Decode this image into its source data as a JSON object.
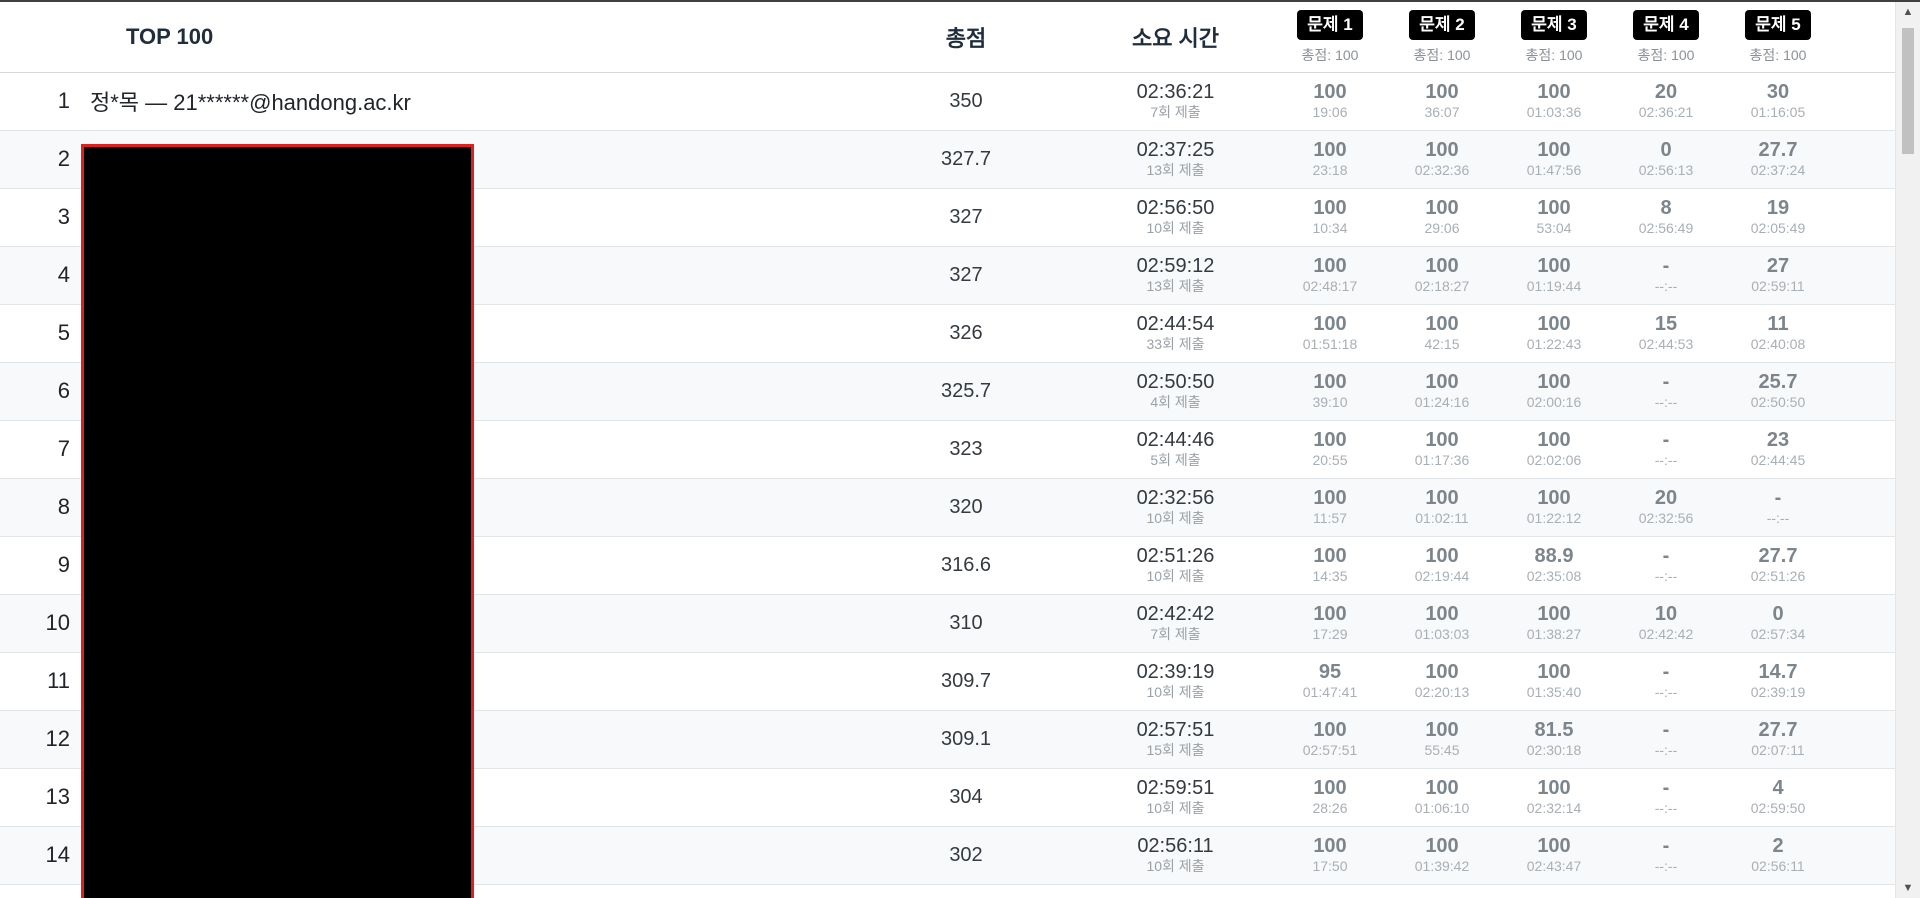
{
  "header": {
    "title": "TOP 100",
    "total_label": "총점",
    "time_label": "소요 시간",
    "problems": [
      {
        "label": "문제 1",
        "total": "총점: 100"
      },
      {
        "label": "문제 2",
        "total": "총점: 100"
      },
      {
        "label": "문제 3",
        "total": "총점: 100"
      },
      {
        "label": "문제 4",
        "total": "총점: 100"
      },
      {
        "label": "문제 5",
        "total": "총점: 100"
      }
    ]
  },
  "rows": [
    {
      "rank": "1",
      "user": "정*목 — 21******@handong.ac.kr",
      "total": "350",
      "time": "02:36:21",
      "submits": "7회 제출",
      "scores": [
        {
          "s": "100",
          "t": "19:06"
        },
        {
          "s": "100",
          "t": "36:07"
        },
        {
          "s": "100",
          "t": "01:03:36"
        },
        {
          "s": "20",
          "t": "02:36:21"
        },
        {
          "s": "30",
          "t": "01:16:05"
        }
      ]
    },
    {
      "rank": "2",
      "user": "",
      "total": "327.7",
      "time": "02:37:25",
      "submits": "13회 제출",
      "scores": [
        {
          "s": "100",
          "t": "23:18"
        },
        {
          "s": "100",
          "t": "02:32:36"
        },
        {
          "s": "100",
          "t": "01:47:56"
        },
        {
          "s": "0",
          "t": "02:56:13"
        },
        {
          "s": "27.7",
          "t": "02:37:24"
        }
      ]
    },
    {
      "rank": "3",
      "user": "",
      "total": "327",
      "time": "02:56:50",
      "submits": "10회 제출",
      "scores": [
        {
          "s": "100",
          "t": "10:34"
        },
        {
          "s": "100",
          "t": "29:06"
        },
        {
          "s": "100",
          "t": "53:04"
        },
        {
          "s": "8",
          "t": "02:56:49"
        },
        {
          "s": "19",
          "t": "02:05:49"
        }
      ]
    },
    {
      "rank": "4",
      "user": "",
      "total": "327",
      "time": "02:59:12",
      "submits": "13회 제출",
      "scores": [
        {
          "s": "100",
          "t": "02:48:17"
        },
        {
          "s": "100",
          "t": "02:18:27"
        },
        {
          "s": "100",
          "t": "01:19:44"
        },
        {
          "s": "-",
          "t": "--:--"
        },
        {
          "s": "27",
          "t": "02:59:11"
        }
      ]
    },
    {
      "rank": "5",
      "user": "",
      "total": "326",
      "time": "02:44:54",
      "submits": "33회 제출",
      "scores": [
        {
          "s": "100",
          "t": "01:51:18"
        },
        {
          "s": "100",
          "t": "42:15"
        },
        {
          "s": "100",
          "t": "01:22:43"
        },
        {
          "s": "15",
          "t": "02:44:53"
        },
        {
          "s": "11",
          "t": "02:40:08"
        }
      ]
    },
    {
      "rank": "6",
      "user": "",
      "total": "325.7",
      "time": "02:50:50",
      "submits": "4회 제출",
      "scores": [
        {
          "s": "100",
          "t": "39:10"
        },
        {
          "s": "100",
          "t": "01:24:16"
        },
        {
          "s": "100",
          "t": "02:00:16"
        },
        {
          "s": "-",
          "t": "--:--"
        },
        {
          "s": "25.7",
          "t": "02:50:50"
        }
      ]
    },
    {
      "rank": "7",
      "user": "",
      "total": "323",
      "time": "02:44:46",
      "submits": "5회 제출",
      "scores": [
        {
          "s": "100",
          "t": "20:55"
        },
        {
          "s": "100",
          "t": "01:17:36"
        },
        {
          "s": "100",
          "t": "02:02:06"
        },
        {
          "s": "-",
          "t": "--:--"
        },
        {
          "s": "23",
          "t": "02:44:45"
        }
      ]
    },
    {
      "rank": "8",
      "user": "",
      "total": "320",
      "time": "02:32:56",
      "submits": "10회 제출",
      "scores": [
        {
          "s": "100",
          "t": "11:57"
        },
        {
          "s": "100",
          "t": "01:02:11"
        },
        {
          "s": "100",
          "t": "01:22:12"
        },
        {
          "s": "20",
          "t": "02:32:56"
        },
        {
          "s": "-",
          "t": "--:--"
        }
      ]
    },
    {
      "rank": "9",
      "user": "",
      "total": "316.6",
      "time": "02:51:26",
      "submits": "10회 제출",
      "scores": [
        {
          "s": "100",
          "t": "14:35"
        },
        {
          "s": "100",
          "t": "02:19:44"
        },
        {
          "s": "88.9",
          "t": "02:35:08"
        },
        {
          "s": "-",
          "t": "--:--"
        },
        {
          "s": "27.7",
          "t": "02:51:26"
        }
      ]
    },
    {
      "rank": "10",
      "user": "",
      "total": "310",
      "time": "02:42:42",
      "submits": "7회 제출",
      "scores": [
        {
          "s": "100",
          "t": "17:29"
        },
        {
          "s": "100",
          "t": "01:03:03"
        },
        {
          "s": "100",
          "t": "01:38:27"
        },
        {
          "s": "10",
          "t": "02:42:42"
        },
        {
          "s": "0",
          "t": "02:57:34"
        }
      ]
    },
    {
      "rank": "11",
      "user": "",
      "total": "309.7",
      "time": "02:39:19",
      "submits": "10회 제출",
      "scores": [
        {
          "s": "95",
          "t": "01:47:41"
        },
        {
          "s": "100",
          "t": "02:20:13"
        },
        {
          "s": "100",
          "t": "01:35:40"
        },
        {
          "s": "-",
          "t": "--:--"
        },
        {
          "s": "14.7",
          "t": "02:39:19"
        }
      ]
    },
    {
      "rank": "12",
      "user": "",
      "total": "309.1",
      "time": "02:57:51",
      "submits": "15회 제출",
      "scores": [
        {
          "s": "100",
          "t": "02:57:51"
        },
        {
          "s": "100",
          "t": "55:45"
        },
        {
          "s": "81.5",
          "t": "02:30:18"
        },
        {
          "s": "-",
          "t": "--:--"
        },
        {
          "s": "27.7",
          "t": "02:07:11"
        }
      ]
    },
    {
      "rank": "13",
      "user": "",
      "total": "304",
      "time": "02:59:51",
      "submits": "10회 제출",
      "scores": [
        {
          "s": "100",
          "t": "28:26"
        },
        {
          "s": "100",
          "t": "01:06:10"
        },
        {
          "s": "100",
          "t": "02:32:14"
        },
        {
          "s": "-",
          "t": "--:--"
        },
        {
          "s": "4",
          "t": "02:59:50"
        }
      ]
    },
    {
      "rank": "14",
      "user": "",
      "total": "302",
      "time": "02:56:11",
      "submits": "10회 제출",
      "scores": [
        {
          "s": "100",
          "t": "17:50"
        },
        {
          "s": "100",
          "t": "01:39:42"
        },
        {
          "s": "100",
          "t": "02:43:47"
        },
        {
          "s": "-",
          "t": "--:--"
        },
        {
          "s": "2",
          "t": "02:56:11"
        }
      ]
    }
  ],
  "scrollbar": {
    "up_icon": "triangle-up-icon",
    "down_icon": "triangle-down-icon"
  }
}
